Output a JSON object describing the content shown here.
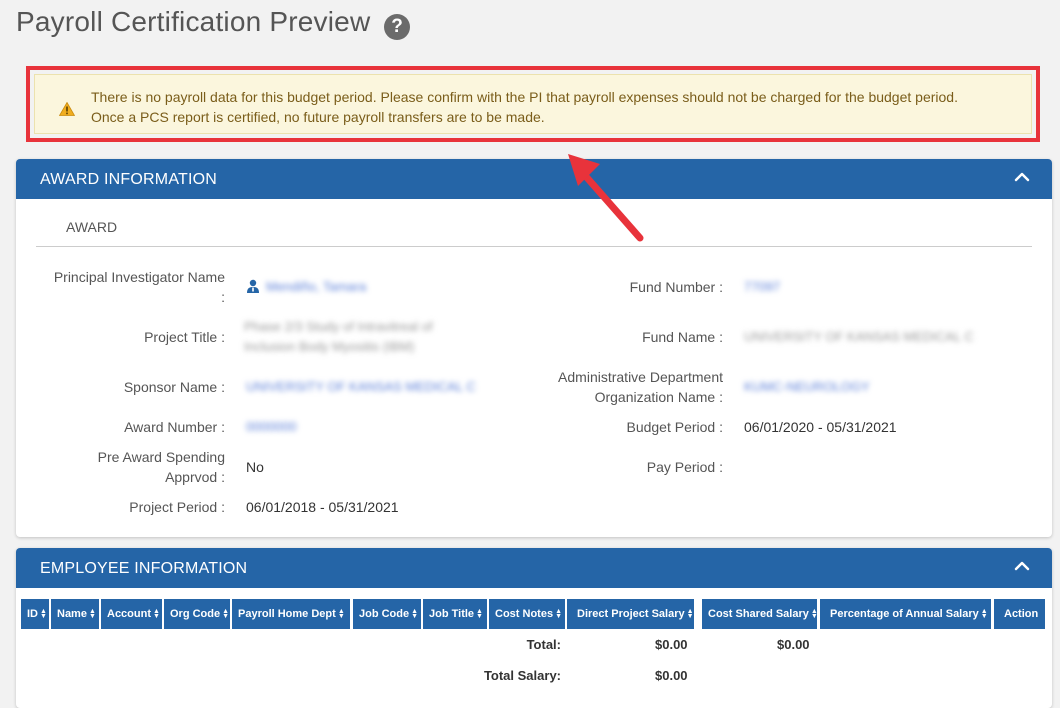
{
  "page": {
    "title": "Payroll Certification Preview",
    "help_symbol": "?"
  },
  "alert": {
    "line1": "There is no payroll data for this budget period. Please confirm with the PI that payroll expenses should not be charged for the budget period.",
    "line2": "Once a PCS report is certified, no future payroll transfers are to be made."
  },
  "award_card": {
    "title": "AWARD INFORMATION",
    "section": "AWARD",
    "left": {
      "pi_label": "Principal Investigator Name",
      "pi_label_colon": ":",
      "pi_value": "Mendiño, Tamara",
      "project_title_label": "Project Title :",
      "project_title_value_1": "Phase 2/3 Study of Intravitreal of",
      "project_title_value_2": "Inclusion Body Myositis (IBM)",
      "sponsor_label": "Sponsor Name :",
      "sponsor_value": "UNIVERSITY OF KANSAS MEDICAL C",
      "award_number_label": "Award Number :",
      "award_number_value": "0000000",
      "pre_award_label_1": "Pre Award Spending",
      "pre_award_label_2": "Apprvod :",
      "pre_award_value": "No",
      "project_period_label": "Project Period :",
      "project_period_value": "06/01/2018 - 05/31/2021"
    },
    "right": {
      "fund_number_label": "Fund Number :",
      "fund_number_value": "77097",
      "fund_name_label": "Fund Name :",
      "fund_name_value": "UNIVERSITY OF KANSAS MEDICAL C",
      "admin_dept_label_1": "Administrative Department",
      "admin_dept_label_2": "Organization Name :",
      "admin_dept_value": "KUMC-NEUROLOGY",
      "budget_period_label": "Budget Period :",
      "budget_period_value": "06/01/2020 - 05/31/2021",
      "pay_period_label": "Pay Period :"
    }
  },
  "employee_card": {
    "title": "EMPLOYEE INFORMATION",
    "columns": [
      "ID",
      "Name",
      "Account",
      "Org Code",
      "Payroll Home Dept",
      "Job Code",
      "Job Title",
      "Cost Notes",
      "Direct Project Salary",
      "Cost Shared Salary",
      "Percentage of Annual Salary",
      "Action"
    ],
    "total_label": "Total:",
    "total_direct": "$0.00",
    "total_cost_shared": "$0.00",
    "total_salary_label": "Total Salary:",
    "total_salary_value": "$0.00"
  },
  "colors": {
    "header_blue": "#2565a7",
    "alert_border_red": "#e8333b",
    "alert_bg": "#fbf6dd",
    "arrow_red": "#e8333b"
  },
  "icons": [
    "help-icon",
    "warning-icon",
    "chevron-up-icon",
    "person-icon",
    "sort-icon",
    "annotation-arrow"
  ]
}
